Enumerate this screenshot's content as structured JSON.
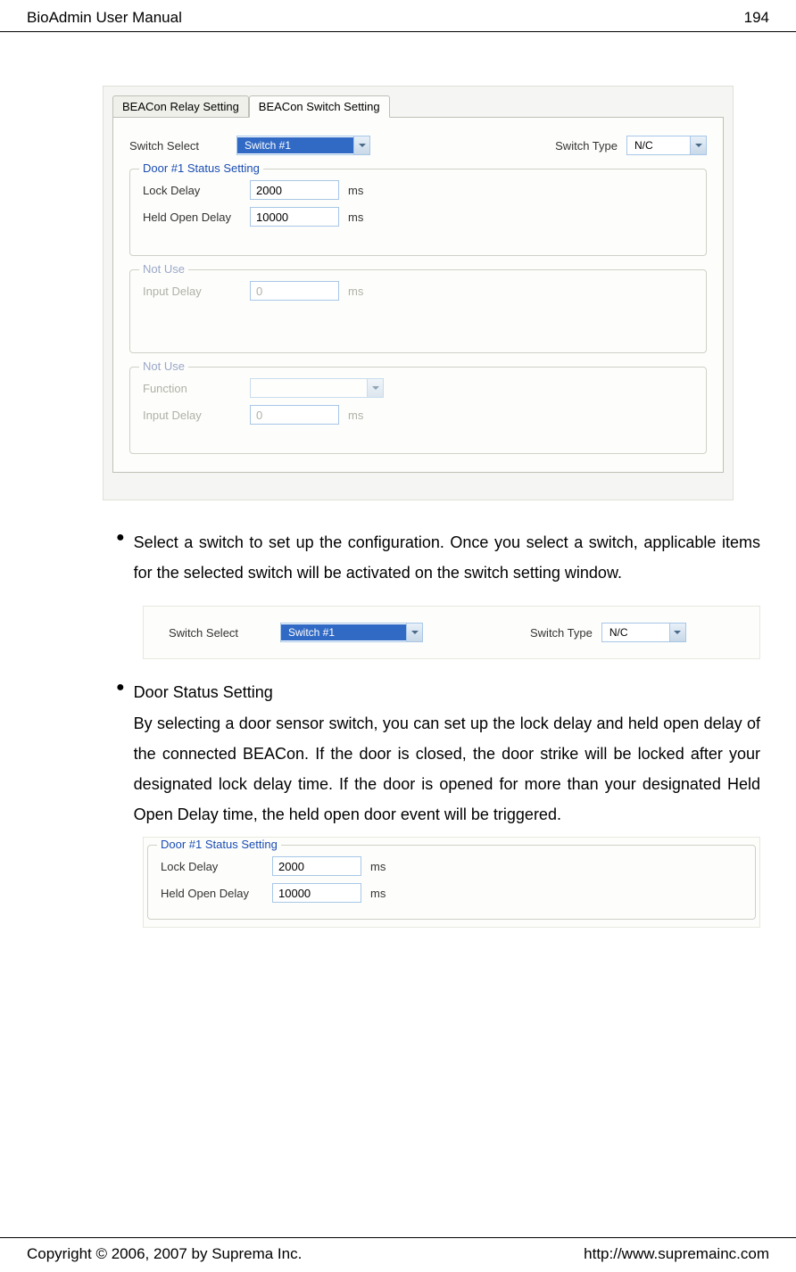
{
  "header": {
    "title": "BioAdmin User Manual",
    "page": "194"
  },
  "screenshot1": {
    "tab1": "BEACon Relay Setting",
    "tab2": "BEACon Switch Setting",
    "switchSelectLabel": "Switch Select",
    "switchSelectValue": "Switch #1",
    "switchTypeLabel": "Switch Type",
    "switchTypeValue": "N/C",
    "group1": {
      "legend": "Door #1 Status Setting",
      "lockDelayLabel": "Lock Delay",
      "lockDelayValue": "2000",
      "lockDelayUnit": "ms",
      "heldOpenLabel": "Held Open Delay",
      "heldOpenValue": "10000",
      "heldOpenUnit": "ms"
    },
    "group2": {
      "legend": "Not Use",
      "inputDelayLabel": "Input Delay",
      "inputDelayValue": "0",
      "inputDelayUnit": "ms"
    },
    "group3": {
      "legend": "Not Use",
      "functionLabel": "Function",
      "functionValue": "",
      "inputDelayLabel": "Input Delay",
      "inputDelayValue": "0",
      "inputDelayUnit": "ms"
    }
  },
  "bullets": {
    "b1": "Select a switch to set up the configuration. Once you select a switch, applicable items for the selected switch will be activated on the switch setting window.",
    "b2title": "Door Status Setting",
    "b2text": "By selecting a door sensor switch, you can set up the lock delay and held open delay of the connected BEACon. If the door is closed, the door strike will be locked after your designated lock delay time. If the door is opened for more than your designated Held Open Delay time, the held open door event will be triggered."
  },
  "inline1": {
    "switchSelectLabel": "Switch Select",
    "switchSelectValue": "Switch #1",
    "switchTypeLabel": "Switch Type",
    "switchTypeValue": "N/C"
  },
  "inline2": {
    "legend": "Door #1 Status Setting",
    "lockDelayLabel": "Lock Delay",
    "lockDelayValue": "2000",
    "lockDelayUnit": "ms",
    "heldOpenLabel": "Held Open Delay",
    "heldOpenValue": "10000",
    "heldOpenUnit": "ms"
  },
  "footer": {
    "copyright": "Copyright © 2006, 2007 by Suprema Inc.",
    "url": "http://www.supremainc.com"
  }
}
